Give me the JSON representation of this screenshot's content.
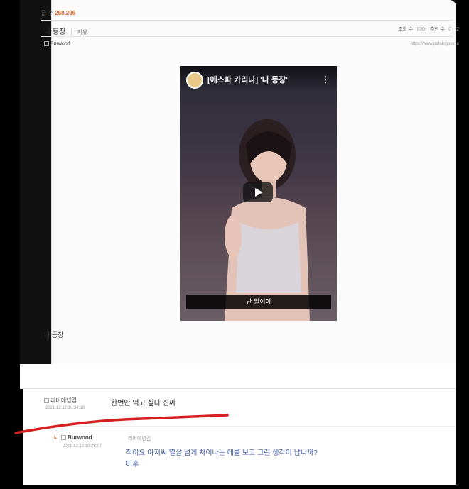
{
  "post": {
    "count_label": "글 수",
    "count_value": "260,206",
    "title": "나 등장",
    "separator": "|",
    "category": "자유",
    "views_label": "조회 수",
    "views_value": "330",
    "likes_label": "추천 수",
    "likes_value": "0",
    "comments_value": "2",
    "author": "Burwood",
    "url": "https://www.pohangpost.c",
    "body_text": "나 등장"
  },
  "video": {
    "title": "[에스파 카리나] '나 등장'",
    "menu_icon": "more-vert-icon",
    "play_icon": "play-icon",
    "caption": "난 말이야"
  },
  "comments": [
    {
      "author": "리버에넘김",
      "date": "2021.12.12 10:34:18",
      "text": "한번만 먹고 싶다 진짜"
    },
    {
      "author": "Burwood",
      "date": "2021.12.12 10:36:07",
      "reply_to": "리버에넘김",
      "text_line1": "적이요 아저씨 열살 넘게 차이나는 애를 보고 그런 생각이 납니까?",
      "text_line2": "어후"
    }
  ],
  "annotation_color": "#d42020"
}
